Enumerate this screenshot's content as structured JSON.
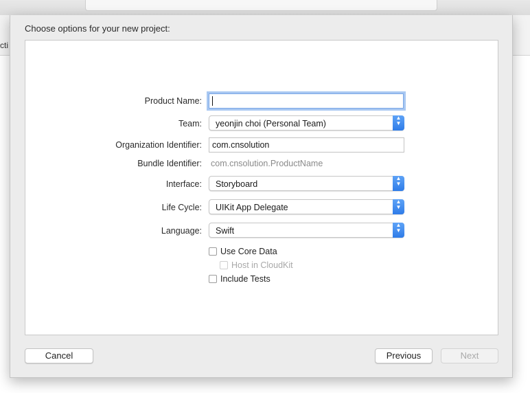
{
  "dialog": {
    "title": "Choose options for your new project:"
  },
  "background": {
    "partial_sidebar_text": "cti"
  },
  "form": {
    "product_name": {
      "label": "Product Name:",
      "value": ""
    },
    "team": {
      "label": "Team:",
      "value": "yeonjin choi (Personal Team)"
    },
    "organization_identifier": {
      "label": "Organization Identifier:",
      "value": "com.cnsolution"
    },
    "bundle_identifier": {
      "label": "Bundle Identifier:",
      "value": "com.cnsolution.ProductName"
    },
    "interface": {
      "label": "Interface:",
      "value": "Storyboard"
    },
    "life_cycle": {
      "label": "Life Cycle:",
      "value": "UIKit App Delegate"
    },
    "language": {
      "label": "Language:",
      "value": "Swift"
    },
    "checkboxes": {
      "use_core_data": {
        "label": "Use Core Data",
        "checked": false
      },
      "host_in_cloudkit": {
        "label": "Host in CloudKit",
        "checked": false,
        "enabled": false
      },
      "include_tests": {
        "label": "Include Tests",
        "checked": false
      }
    }
  },
  "buttons": {
    "cancel": "Cancel",
    "previous": "Previous",
    "next": "Next"
  },
  "colors": {
    "accent": "#2f7ce8",
    "focus_ring": "#a9c8f2"
  }
}
